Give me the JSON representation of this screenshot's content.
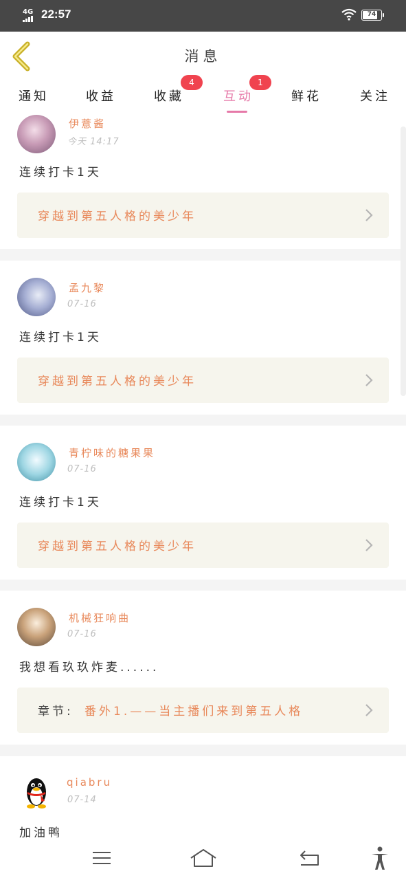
{
  "status_bar": {
    "network": "4G",
    "time": "22:57",
    "battery": "74",
    "battery_level": 0.74
  },
  "header": {
    "title": "消息",
    "back_icon": "chevron-left-icon"
  },
  "tabs": [
    {
      "label": "通知",
      "badge": ""
    },
    {
      "label": "收益",
      "badge": ""
    },
    {
      "label": "收藏",
      "badge": "4"
    },
    {
      "label": "互动",
      "badge": "1",
      "active": true
    },
    {
      "label": "鲜花",
      "badge": ""
    },
    {
      "label": "关注",
      "badge": ""
    }
  ],
  "colors": {
    "accent": "#e679a8",
    "username": "#e8885a",
    "badge": "#f0434f",
    "status_bar": "#474747",
    "book_box": "#f6f5ed"
  },
  "feed": [
    {
      "username": "伊薏酱",
      "time": "今天 14:17",
      "content": "连续打卡1天",
      "book_prefix": "",
      "book_title": "穿越到第五人格的美少年"
    },
    {
      "username": "孟九黎",
      "time": "07-16",
      "content": "连续打卡1天",
      "book_prefix": "",
      "book_title": "穿越到第五人格的美少年"
    },
    {
      "username": "青柠味的糖果果",
      "time": "07-16",
      "content": "连续打卡1天",
      "book_prefix": "",
      "book_title": "穿越到第五人格的美少年"
    },
    {
      "username": "机械狂响曲",
      "time": "07-16",
      "content": "我想看玖玖炸麦......",
      "book_prefix": "章节:",
      "book_title": "番外1.——当主播们来到第五人格"
    },
    {
      "username": "qiabru",
      "time": "07-14",
      "content": "加油鸭",
      "book_prefix": "",
      "book_title": ""
    }
  ],
  "nav_bar": {
    "icons": [
      "menu-icon",
      "home-icon",
      "back-icon",
      "accessibility-icon"
    ]
  }
}
